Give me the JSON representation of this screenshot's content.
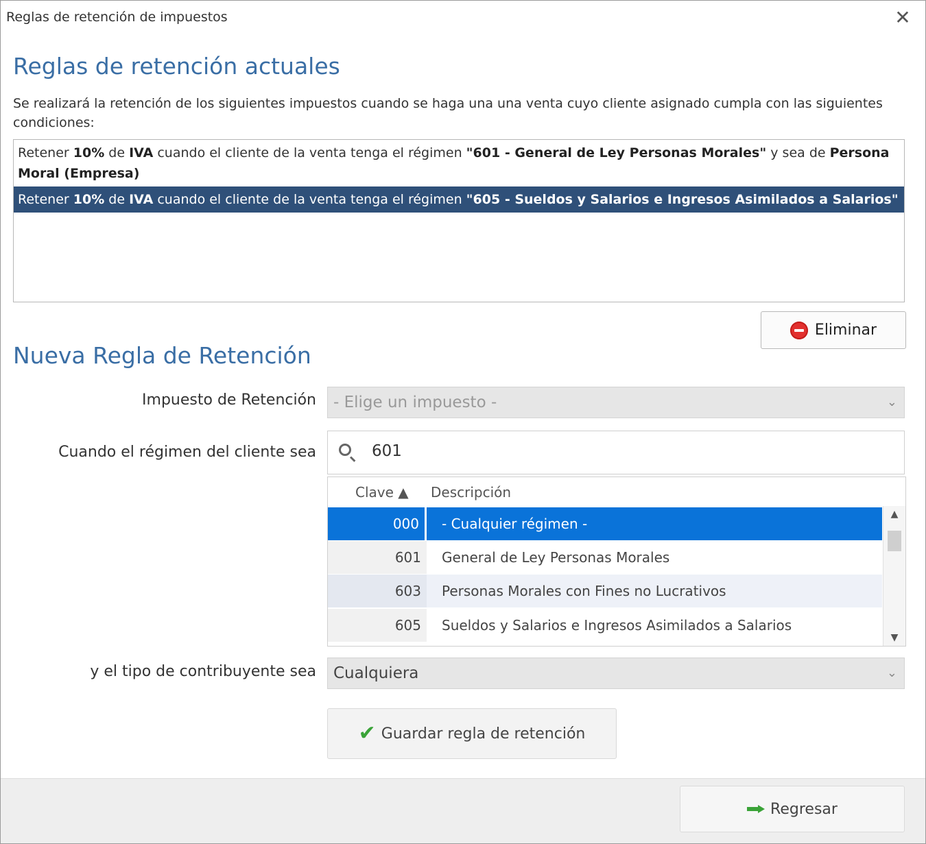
{
  "window": {
    "title": "Reglas de retención de impuestos",
    "close_glyph": "✕"
  },
  "current": {
    "heading": "Reglas de retención actuales",
    "description": "Se realizará la retención de los siguientes impuestos cuando se haga una una venta cuyo cliente asignado cumpla con las siguientes condiciones:",
    "rules": [
      {
        "p1": "Retener ",
        "b1": "10%",
        "p2": " de ",
        "b2": "IVA",
        "p3": " cuando el cliente de la venta tenga el régimen ",
        "b3": "\"601 - General de Ley Personas Morales\"",
        "p4": "  y sea de ",
        "b4": "Persona Moral (Empresa)",
        "selected": false
      },
      {
        "p1": "Retener ",
        "b1": "10%",
        "p2": " de ",
        "b2": "IVA",
        "p3": " cuando el cliente de la venta tenga el régimen ",
        "b3": "\"605 - Sueldos y Salarios e Ingresos Asimilados a Salarios\"",
        "p4": "",
        "b4": "",
        "selected": true
      }
    ],
    "delete_label": "Eliminar"
  },
  "new_rule": {
    "heading": "Nueva Regla de Retención",
    "tax_label": "Impuesto de Retención",
    "tax_placeholder": "- Elige un impuesto -",
    "regime_label": "Cuando el régimen del cliente sea",
    "search_value": "601",
    "grid": {
      "col_clave": "Clave ▲",
      "col_desc": "Descripción",
      "rows": [
        {
          "clave": "000",
          "desc": "- Cualquier régimen -",
          "state": "selected"
        },
        {
          "clave": "601",
          "desc": "General de Ley Personas Morales",
          "state": "normal"
        },
        {
          "clave": "603",
          "desc": "Personas Morales con Fines no Lucrativos",
          "state": "alt"
        },
        {
          "clave": "605",
          "desc": "Sueldos y Salarios e Ingresos Asimilados a Salarios",
          "state": "normal"
        }
      ]
    },
    "taxpayer_label": "y el tipo de contribuyente sea",
    "taxpayer_value": "Cualquiera",
    "save_label": "Guardar regla de retención"
  },
  "footer": {
    "back_label": "Regresar"
  },
  "colors": {
    "heading": "#3a6ea5",
    "rule_selected_bg": "#2f5079",
    "grid_selected_bg": "#0a73d9",
    "delete_icon": "#e2302e",
    "ok_green": "#3aa338"
  }
}
